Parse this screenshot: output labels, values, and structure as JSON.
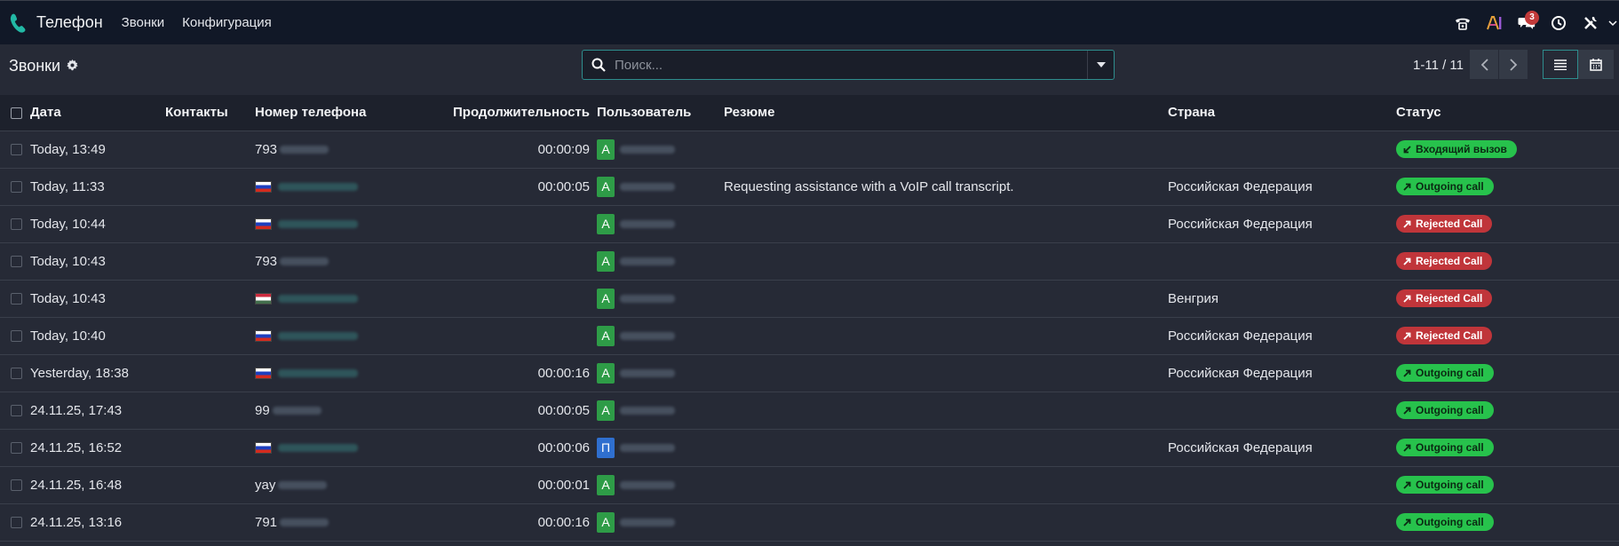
{
  "app": {
    "title": "Телефон",
    "menu": [
      "Звонки",
      "Конфигурация"
    ],
    "chat_badge": "3"
  },
  "control": {
    "breadcrumb": "Звонки",
    "search_placeholder": "Поиск...",
    "pager": "1-11 / 11"
  },
  "table": {
    "columns": [
      "Дата",
      "Контакты",
      "Номер телефона",
      "Продолжительность",
      "Пользователь",
      "Резюме",
      "Страна",
      "Статус"
    ],
    "rows": [
      {
        "date": "Today, 13:49",
        "flag": "",
        "phone": "793",
        "duration": "00:00:09",
        "avatar": "A",
        "avatar_color": "#2e9c47",
        "summary": "",
        "country": "",
        "status": "Входящий вызов",
        "status_type": "in"
      },
      {
        "date": "Today, 11:33",
        "flag": "ru",
        "phone": "",
        "duration": "00:00:05",
        "avatar": "A",
        "avatar_color": "#2e9c47",
        "summary": "Requesting assistance with a VoIP call transcript.",
        "country": "Российская Федерация",
        "status": "Outgoing call",
        "status_type": "out"
      },
      {
        "date": "Today, 10:44",
        "flag": "ru",
        "phone": "",
        "duration": "",
        "avatar": "A",
        "avatar_color": "#2e9c47",
        "summary": "",
        "country": "Российская Федерация",
        "status": "Rejected Call",
        "status_type": "rej"
      },
      {
        "date": "Today, 10:43",
        "flag": "",
        "phone": "793",
        "duration": "",
        "avatar": "A",
        "avatar_color": "#2e9c47",
        "summary": "",
        "country": "",
        "status": "Rejected Call",
        "status_type": "rej"
      },
      {
        "date": "Today, 10:43",
        "flag": "hu",
        "phone": "",
        "duration": "",
        "avatar": "A",
        "avatar_color": "#2e9c47",
        "summary": "",
        "country": "Венгрия",
        "status": "Rejected Call",
        "status_type": "rej"
      },
      {
        "date": "Today, 10:40",
        "flag": "ru",
        "phone": "",
        "duration": "",
        "avatar": "A",
        "avatar_color": "#2e9c47",
        "summary": "",
        "country": "Российская Федерация",
        "status": "Rejected Call",
        "status_type": "rej"
      },
      {
        "date": "Yesterday, 18:38",
        "flag": "ru",
        "phone": "",
        "duration": "00:00:16",
        "avatar": "A",
        "avatar_color": "#2e9c47",
        "summary": "",
        "country": "Российская Федерация",
        "status": "Outgoing call",
        "status_type": "out"
      },
      {
        "date": "24.11.25, 17:43",
        "flag": "",
        "phone": "99",
        "duration": "00:00:05",
        "avatar": "A",
        "avatar_color": "#2e9c47",
        "summary": "",
        "country": "",
        "status": "Outgoing call",
        "status_type": "out"
      },
      {
        "date": "24.11.25, 16:52",
        "flag": "ru",
        "phone": "",
        "duration": "00:00:06",
        "avatar": "П",
        "avatar_color": "#2f6fcf",
        "summary": "",
        "country": "Российская Федерация",
        "status": "Outgoing call",
        "status_type": "out"
      },
      {
        "date": "24.11.25, 16:48",
        "flag": "",
        "phone": "yay",
        "duration": "00:00:01",
        "avatar": "A",
        "avatar_color": "#2e9c47",
        "summary": "",
        "country": "",
        "status": "Outgoing call",
        "status_type": "out"
      },
      {
        "date": "24.11.25, 13:16",
        "flag": "",
        "phone": "791",
        "duration": "00:00:16",
        "avatar": "A",
        "avatar_color": "#2e9c47",
        "summary": "",
        "country": "",
        "status": "Outgoing call",
        "status_type": "out"
      }
    ]
  },
  "icons": {
    "app": "phone-icon",
    "breadcrumb_settings": "gear-icon",
    "search": "search-icon",
    "tray": [
      "voip-phone-icon",
      "ai-icon",
      "chat-icon",
      "clock-icon",
      "tools-icon"
    ]
  },
  "colors": {
    "accent": "#2e8d8d",
    "outgoing": "#27c24c",
    "rejected": "#c0353a",
    "avatar_green": "#2e9c47",
    "avatar_blue": "#2f6fcf"
  }
}
